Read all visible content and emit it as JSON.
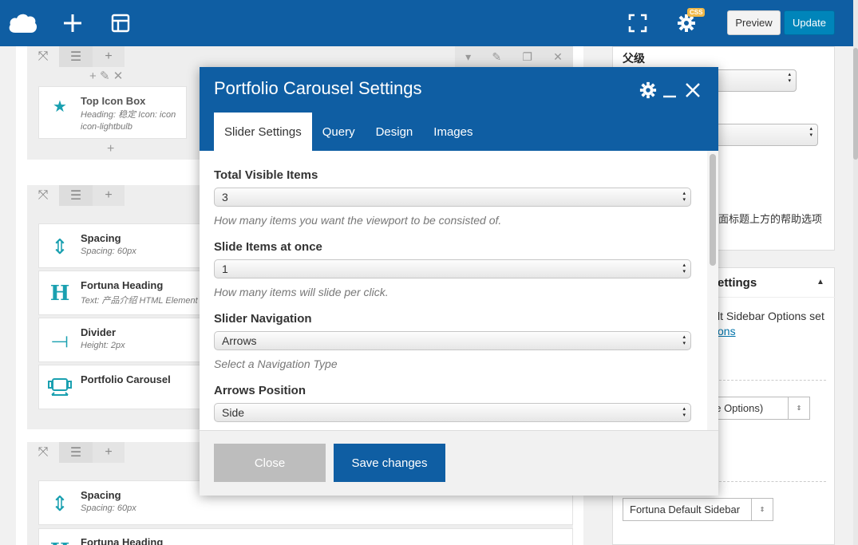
{
  "topbar": {
    "preview_label": "Preview",
    "update_label": "Update",
    "css_badge": "CSS"
  },
  "builder": {
    "top_section": {
      "element_title": "Top Icon Box",
      "element_sub": "Heading: 稳定 Icon: icon icon-lightbulb"
    },
    "section2": {
      "elements": [
        {
          "title": "Spacing",
          "sub": "Spacing: 60px"
        },
        {
          "title": "Fortuna Heading",
          "sub": "Text: 产品介绍 HTML Element"
        },
        {
          "title": "Divider",
          "sub": "Height: 2px"
        },
        {
          "title": "Portfolio Carousel",
          "sub": ""
        }
      ]
    },
    "section3": {
      "elements": [
        {
          "title": "Spacing",
          "sub": "Spacing: 60px"
        },
        {
          "title": "Fortuna Heading",
          "sub": ""
        }
      ]
    }
  },
  "sidebar": {
    "parent_label": "父级",
    "help_text": "面标题上方的帮助选项",
    "panel_title": "ettings",
    "options_text": "lt Sidebar Options set",
    "options_link": "ons",
    "select_theme_options": "ne Options)",
    "select_sidebar": "Fortuna Default Sidebar"
  },
  "modal": {
    "title": "Portfolio Carousel Settings",
    "tabs": [
      "Slider Settings",
      "Query",
      "Design",
      "Images"
    ],
    "fields": [
      {
        "label": "Total Visible Items",
        "value": "3",
        "desc": "How many items you want the viewport to be consisted of."
      },
      {
        "label": "Slide Items at once",
        "value": "1",
        "desc": "How many items will slide per click."
      },
      {
        "label": "Slider Navigation",
        "value": "Arrows",
        "desc": "Select a Navigation Type"
      },
      {
        "label": "Arrows Position",
        "value": "Side",
        "desc": ""
      }
    ],
    "close_label": "Close",
    "save_label": "Save changes"
  },
  "colors": {
    "brand_blue": "#0f5ea3",
    "accent_teal": "#1aa0b0",
    "update_blue": "#0085ba"
  }
}
